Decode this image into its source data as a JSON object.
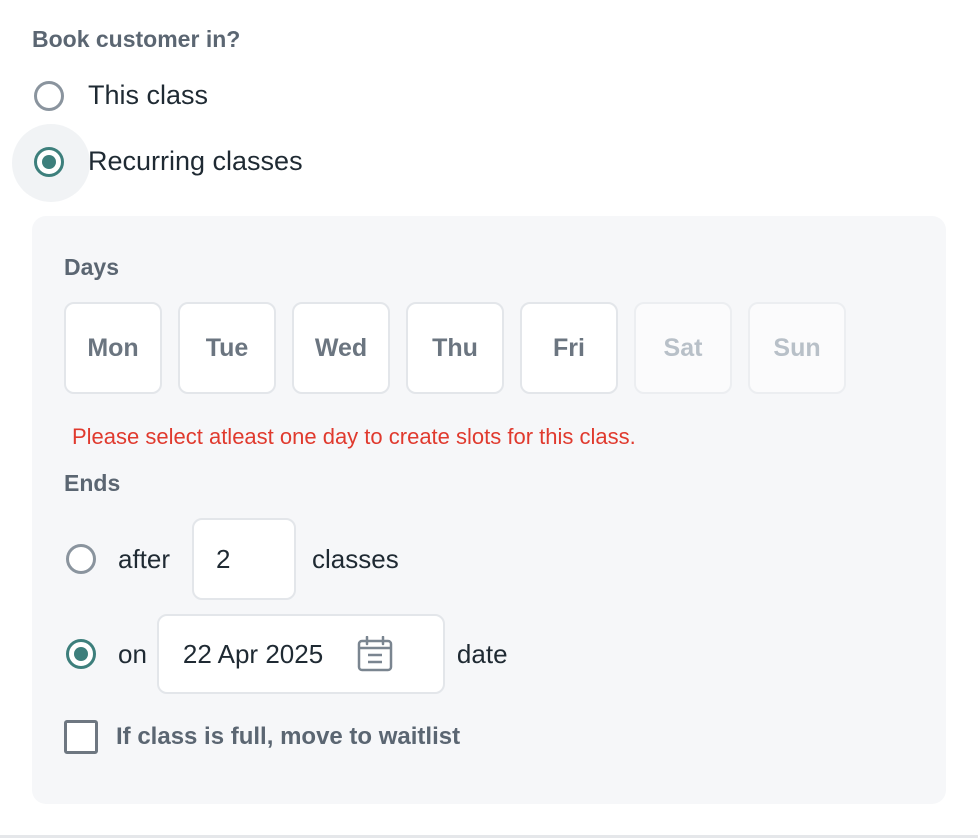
{
  "book": {
    "title": "Book customer in?",
    "options": [
      {
        "label": "This class",
        "checked": false
      },
      {
        "label": "Recurring classes",
        "checked": true
      }
    ]
  },
  "recurring": {
    "days_title": "Days",
    "days": [
      {
        "label": "Mon",
        "enabled": true
      },
      {
        "label": "Tue",
        "enabled": true
      },
      {
        "label": "Wed",
        "enabled": true
      },
      {
        "label": "Thu",
        "enabled": true
      },
      {
        "label": "Fri",
        "enabled": true
      },
      {
        "label": "Sat",
        "enabled": false
      },
      {
        "label": "Sun",
        "enabled": false
      }
    ],
    "error": "Please select atleast one day to create slots for this class.",
    "ends_title": "Ends",
    "after": {
      "prefix": "after",
      "value": "2",
      "suffix": "classes",
      "checked": false
    },
    "on": {
      "prefix": "on",
      "value": "22 Apr 2025",
      "suffix": "date",
      "checked": true,
      "icon": "calendar-icon"
    },
    "waitlist": {
      "label": "If class is full, move to waitlist",
      "checked": false
    }
  },
  "colors": {
    "accent": "#3d7f7c",
    "error": "#e03a2e"
  }
}
